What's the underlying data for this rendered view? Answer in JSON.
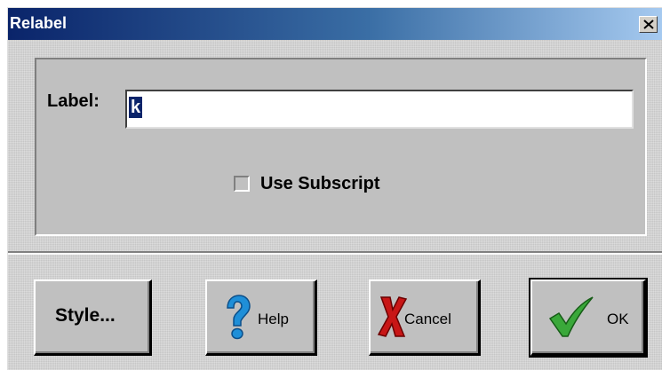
{
  "window": {
    "title": "Relabel"
  },
  "panel": {
    "label_caption": "Label:",
    "label_value": "k",
    "use_subscript_label": "Use Subscript",
    "use_subscript_checked": false
  },
  "buttons": {
    "style": "Style...",
    "help": "Help",
    "cancel": "Cancel",
    "ok": "OK"
  },
  "icons": {
    "close": "close-icon",
    "help": "question-mark-icon",
    "cancel": "red-x-icon",
    "ok": "green-checkmark-icon"
  }
}
